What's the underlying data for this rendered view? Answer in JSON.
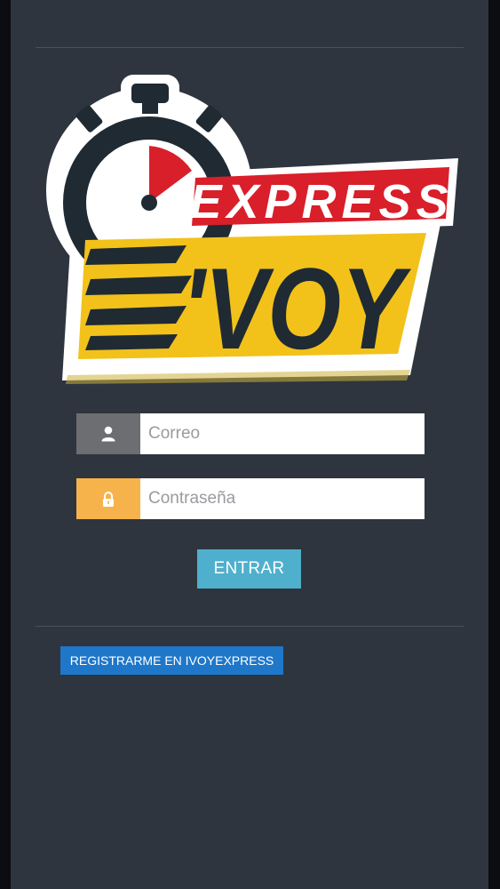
{
  "app": {
    "logo": {
      "word_top": "EXPRESS",
      "word_bottom": "'VOY"
    }
  },
  "login": {
    "email": {
      "placeholder": "Correo",
      "value": "",
      "icon": "user-icon",
      "addon_color": "#6d6e71"
    },
    "password": {
      "placeholder": "Contraseña",
      "value": "",
      "icon": "lock-icon",
      "addon_color": "#f6b34b"
    },
    "submit_label": "ENTRAR"
  },
  "register": {
    "label": "REGISTRARME EN IVOYEXPRESS"
  },
  "colors": {
    "background": "#2e353f",
    "submit": "#4fb0cd",
    "register": "#1f77c9",
    "logo_red": "#d81f2a",
    "logo_yellow": "#f2c21b",
    "logo_dark": "#1f2a33"
  }
}
